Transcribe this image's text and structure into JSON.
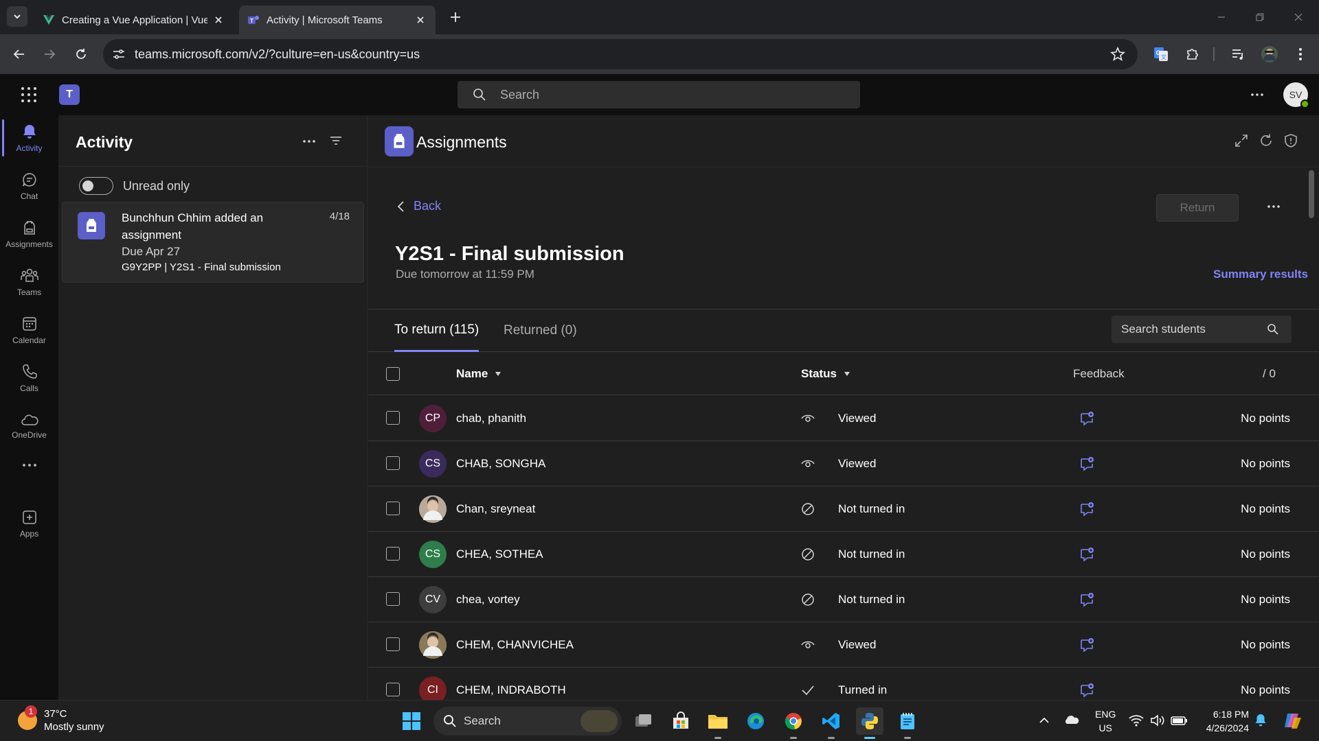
{
  "browser": {
    "tabs": [
      {
        "title": "Creating a Vue Application | Vue.js",
        "icon": "vue-icon",
        "active": false
      },
      {
        "title": "Activity | Microsoft Teams",
        "icon": "teams-icon",
        "active": true
      }
    ],
    "url": "teams.microsoft.com/v2/?culture=en-us&country=us"
  },
  "teams_header": {
    "search_placeholder": "Search",
    "user_initials": "SV"
  },
  "rail": [
    {
      "label": "Activity",
      "icon": "bell-icon",
      "active": true
    },
    {
      "label": "Chat",
      "icon": "chat-icon",
      "active": false
    },
    {
      "label": "Assignments",
      "icon": "backpack-icon",
      "active": false
    },
    {
      "label": "Teams",
      "icon": "people-icon",
      "active": false
    },
    {
      "label": "Calendar",
      "icon": "calendar-icon",
      "active": false
    },
    {
      "label": "Calls",
      "icon": "phone-icon",
      "active": false
    },
    {
      "label": "OneDrive",
      "icon": "cloud-icon",
      "active": false
    },
    {
      "label": "Apps",
      "icon": "add-app-icon",
      "active": false
    }
  ],
  "activity": {
    "title": "Activity",
    "unread_only_label": "Unread only",
    "unread_only_on": false,
    "feed": [
      {
        "title": "Bunchhun Chhim added an assignment",
        "date": "4/18",
        "due": "Due Apr 27",
        "meta": "G9Y2PP | Y2S1 - Final submission"
      }
    ]
  },
  "assignments": {
    "app_title": "Assignments",
    "back_label": "Back",
    "return_label": "Return",
    "assignment_title": "Y2S1 - Final submission",
    "due_text": "Due tomorrow at 11:59 PM",
    "summary_label": "Summary results",
    "tabs": [
      {
        "label": "To return (115)",
        "active": true
      },
      {
        "label": "Returned (0)",
        "active": false
      }
    ],
    "search_students_placeholder": "Search students",
    "columns": {
      "name": "Name",
      "status": "Status",
      "feedback": "Feedback",
      "points": "/ 0"
    },
    "students": [
      {
        "initials": "CP",
        "name": "chab, phanith",
        "status": "Viewed",
        "status_icon": "eye-icon",
        "avatar_color": "#4f1f3a",
        "photo": false,
        "points": "No points"
      },
      {
        "initials": "CS",
        "name": "CHAB, SONGHA",
        "status": "Viewed",
        "status_icon": "eye-icon",
        "avatar_color": "#3b2a5c",
        "photo": false,
        "points": "No points"
      },
      {
        "initials": "",
        "name": "Chan, sreyneat",
        "status": "Not turned in",
        "status_icon": "not-allowed-icon",
        "avatar_color": "#b8a99a",
        "photo": true,
        "points": "No points"
      },
      {
        "initials": "CS",
        "name": "CHEA, SOTHEA",
        "status": "Not turned in",
        "status_icon": "not-allowed-icon",
        "avatar_color": "#2f7d4a",
        "photo": false,
        "points": "No points"
      },
      {
        "initials": "CV",
        "name": "chea, vortey",
        "status": "Not turned in",
        "status_icon": "not-allowed-icon",
        "avatar_color": "#3d3d3d",
        "photo": false,
        "points": "No points"
      },
      {
        "initials": "",
        "name": "CHEM, CHANVICHEA",
        "status": "Viewed",
        "status_icon": "eye-icon",
        "avatar_color": "#8a7a5a",
        "photo": true,
        "points": "No points"
      },
      {
        "initials": "CI",
        "name": "CHEM, INDRABOTH",
        "status": "Turned in",
        "status_icon": "check-icon",
        "avatar_color": "#7a1f22",
        "photo": false,
        "points": "No points"
      }
    ]
  },
  "taskbar": {
    "weather_temp": "37°C",
    "weather_desc": "Mostly sunny",
    "weather_badge": "1",
    "search_label": "Search",
    "lang_1": "ENG",
    "lang_2": "US",
    "time": "6:18 PM",
    "date": "4/26/2024"
  },
  "colors": {
    "accent": "#7f85f5",
    "brand": "#5b5fc7",
    "background": "#1f1f1f"
  }
}
